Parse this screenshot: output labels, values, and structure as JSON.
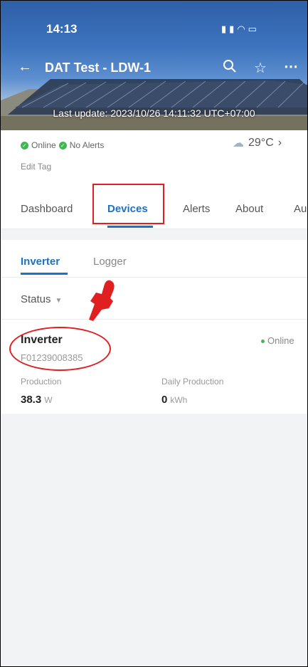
{
  "status_bar": {
    "time": "14:13",
    "icons": "signal-icon wifi-icon battery-icon"
  },
  "header": {
    "title": "DAT Test - LDW-1",
    "last_update": "Last update: 2023/10/26 14:11:32 UTC+07:00",
    "icons": [
      "back-arrow-icon",
      "search-icon",
      "star-icon",
      "more-icon"
    ]
  },
  "info": {
    "online": "Online",
    "no_alerts": "No Alerts",
    "temperature": "29°C",
    "edit_tag": "Edit Tag"
  },
  "tabs": [
    {
      "label": "Dashboard",
      "active": false
    },
    {
      "label": "Devices",
      "active": true
    },
    {
      "label": "Alerts",
      "active": false
    },
    {
      "label": "About",
      "active": false
    },
    {
      "label": "Au",
      "active": false
    }
  ],
  "subtabs": [
    {
      "label": "Inverter",
      "active": true
    },
    {
      "label": "Logger",
      "active": false
    }
  ],
  "filter": {
    "label": "Status"
  },
  "device": {
    "name": "Inverter",
    "serial": "F01239008385",
    "status": "Online",
    "production_label": "Production",
    "production_value": "38.3",
    "production_unit": "W",
    "daily_label": "Daily Production",
    "daily_value": "0",
    "daily_unit": "kWh"
  },
  "colors": {
    "accent": "#1a73c8",
    "online": "#3dba4e",
    "annotation": "#e02020"
  }
}
